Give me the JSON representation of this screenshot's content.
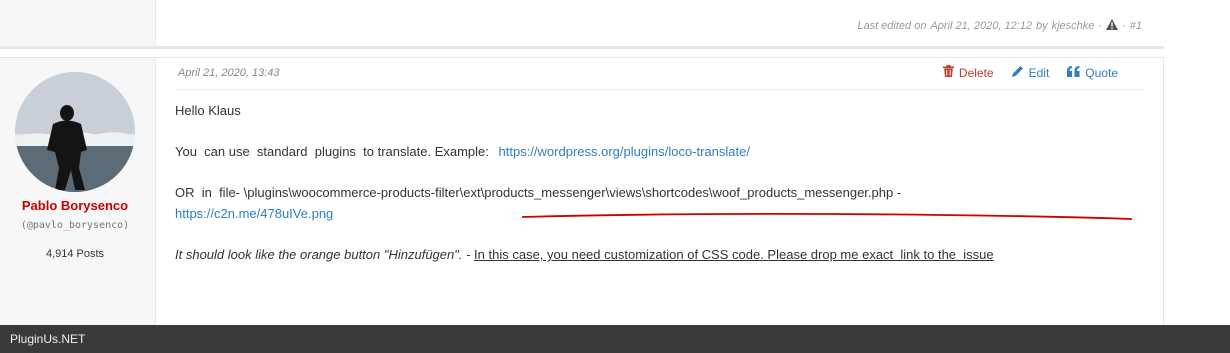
{
  "previous_post": {
    "edit_prefix": "Last edited on",
    "edit_date": "April 21, 2020, 12:12",
    "edit_by": "by",
    "edit_user": "kjeschke",
    "separator1": "·",
    "separator2": "·",
    "post_number": "#1"
  },
  "post": {
    "date": "April 21, 2020, 13:43",
    "actions": {
      "delete": "Delete",
      "edit": "Edit",
      "quote": "Quote"
    },
    "author": {
      "name": "Pablo Borysenco",
      "handle": "(@pavlo_borysenco)",
      "posts": "4,914 Posts"
    },
    "content": {
      "greeting": "Hello Klaus",
      "line2_text": "You  can use  standard  plugins  to translate. Example:",
      "line2_link": "https://wordpress.org/plugins/loco-translate/",
      "line3_text": "OR  in  file- \\plugins\\woocommerce-products-filter\\ext\\products_messenger\\views\\shortcodes\\woof_products_messenger.php -",
      "line3_link": "https://c2n.me/478uIVe.png",
      "line4_quote": "It should look like the orange button \"Hinzufügen\". -",
      "line4_reply": "In this case, you need customization of CSS code. Please drop me exact  link to the  issue"
    }
  },
  "footer": {
    "brand": "PluginUs.NET"
  },
  "colors": {
    "author_name": "#c90000",
    "link": "#2d7fc1",
    "delete": "#c0392b",
    "footer_bg": "#3a3a3a",
    "annotation_red": "#d00000"
  }
}
